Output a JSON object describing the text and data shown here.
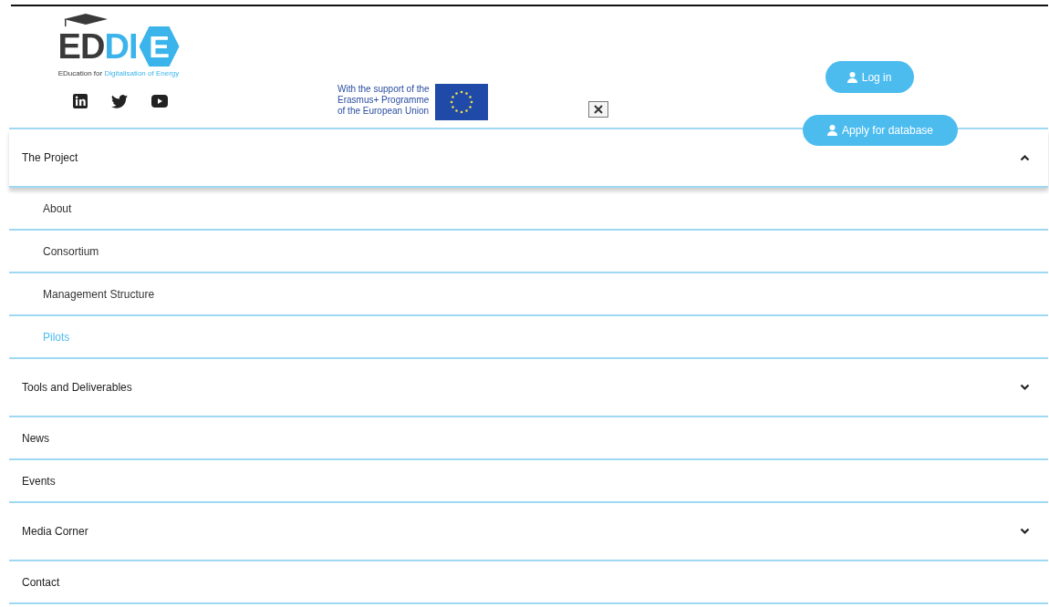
{
  "logo": {
    "parts": [
      {
        "text": "ED",
        "kind": "dark"
      },
      {
        "text": "DI",
        "kind": "accent"
      },
      {
        "text": "E",
        "kind": "hexagon"
      }
    ],
    "tagline": [
      {
        "text": "EDucation for ",
        "kind": "dark"
      },
      {
        "text": "Digitalisation of Energy",
        "kind": "accent"
      }
    ]
  },
  "social": [
    {
      "kind": "linkedin"
    },
    {
      "kind": "twitter"
    },
    {
      "kind": "youtube"
    }
  ],
  "support_text": [
    "With the support of the",
    "Erasmus+ Programme",
    "of the European Union"
  ],
  "buttons": [
    {
      "label": "Log in",
      "kind": "login"
    },
    {
      "label": "Apply for database",
      "kind": "apply"
    }
  ],
  "menu": [
    {
      "label": "The Project",
      "expanded": true,
      "children": [
        {
          "label": "About",
          "selected": false
        },
        {
          "label": "Consortium",
          "selected": false
        },
        {
          "label": "Management Structure",
          "selected": false
        },
        {
          "label": "Pilots",
          "selected": true
        }
      ]
    },
    {
      "label": "Tools and Deliverables",
      "expanded": false
    },
    {
      "label": "News"
    },
    {
      "label": "Events"
    },
    {
      "label": "Media Corner",
      "expanded": false
    },
    {
      "label": "Contact"
    }
  ]
}
